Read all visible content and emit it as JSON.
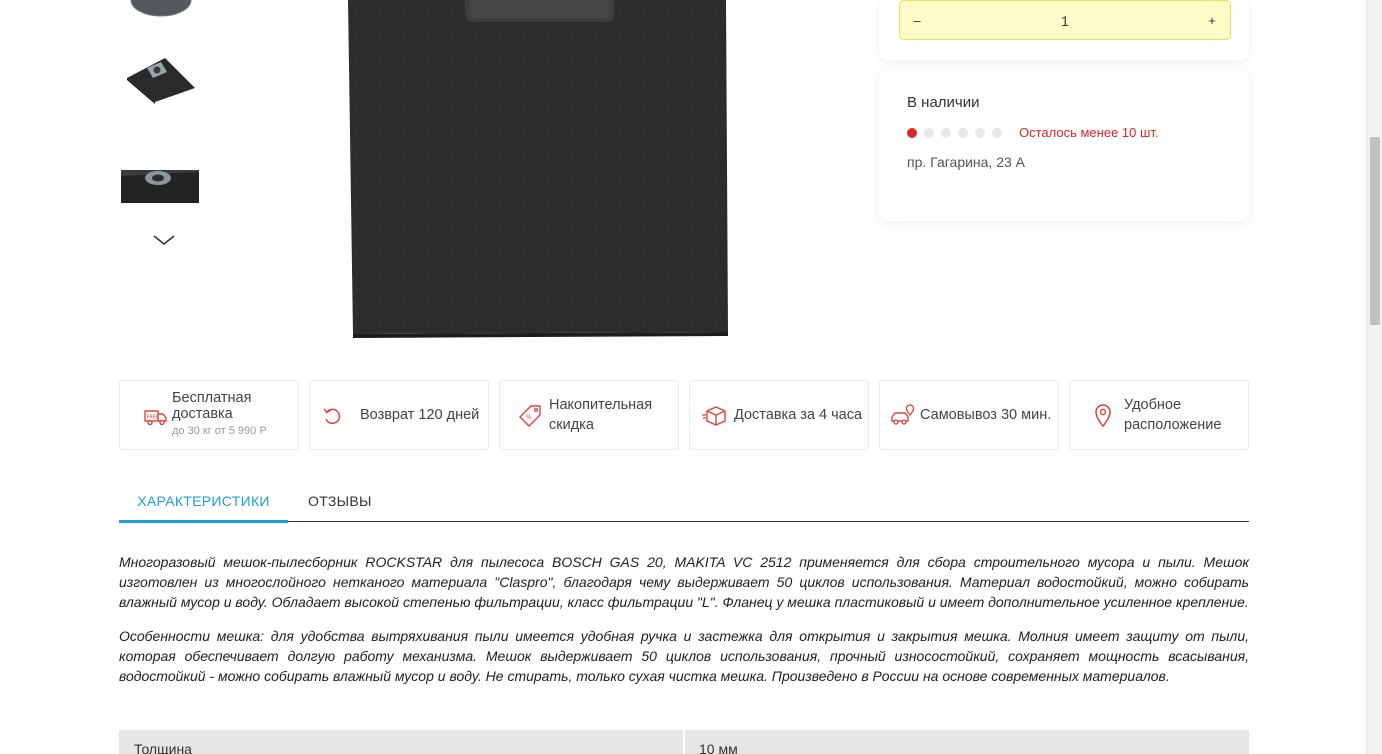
{
  "gallery": {
    "thumbnails": [
      "product-bag-thumb-1",
      "product-bag-thumb-2",
      "product-bag-thumb-3"
    ],
    "next_icon": "chevron-down-icon"
  },
  "purchase": {
    "quantity": "1",
    "minus_label": "–",
    "plus_label": "+"
  },
  "stock": {
    "title": "В наличии",
    "level_filled": 1,
    "level_total": 6,
    "left_text": "Осталось менее 10 шт.",
    "address": "пр. Гагарина, 23 А",
    "accent_color": "#e02424"
  },
  "features": [
    {
      "icon": "truck-free-icon",
      "label": "Бесплатная доставка",
      "sub": "до 30 кг от 5 990 Р"
    },
    {
      "icon": "return-icon",
      "label": "Возврат 120 дней"
    },
    {
      "icon": "discount-tag-icon",
      "label": "Накопительная скидка"
    },
    {
      "icon": "box-delivery-icon",
      "label": "Доставка за 4 часа"
    },
    {
      "icon": "car-pickup-icon",
      "label": "Самовывоз 30 мин."
    },
    {
      "icon": "location-pin-icon",
      "label": "Удобное расположение"
    }
  ],
  "tabs": [
    {
      "label": "ХАРАКТЕРИСТИКИ",
      "active": true
    },
    {
      "label": "ОТЗЫВЫ",
      "active": false
    }
  ],
  "description": {
    "p1": "Многоразовый мешок-пылесборник ROCKSTAR для пылесоса BOSCH GAS 20, MAKITA VC 2512 применяется для сбора строительного мусора и пыли. Мешок изготовлен из многослойного нетканого материала \"Claspro\", благодаря чему выдерживает 50 циклов использования. Материал водостойкий, можно собирать влажный мусор и воду. Обладает высокой степенью фильтрации, класс фильтрации \"L\". Фланец у мешка пластиковый и имеет дополнительное усиленное крепление.",
    "p2": "Особенности мешка: для удобства вытряхивания пыли имеется удобная ручка и застежка для открытия и закрытия мешка. Молния имеет защиту от пыли, которая обеспечивает долгую работу механизма. Мешок выдерживает 50 циклов использования, прочный износостойкий, сохраняет мощность всасывания, водостойкий - можно собирать влажный мусор и воду. Не стирать, только сухая чистка мешка. Произведено в России на основе современных материалов."
  },
  "specs": [
    {
      "name": "Толщина",
      "value": "10 мм"
    }
  ],
  "colors": {
    "accent_blue": "#1e9fd6",
    "icon_red": "#e0413c",
    "qty_bg": "#fdfbc8"
  }
}
